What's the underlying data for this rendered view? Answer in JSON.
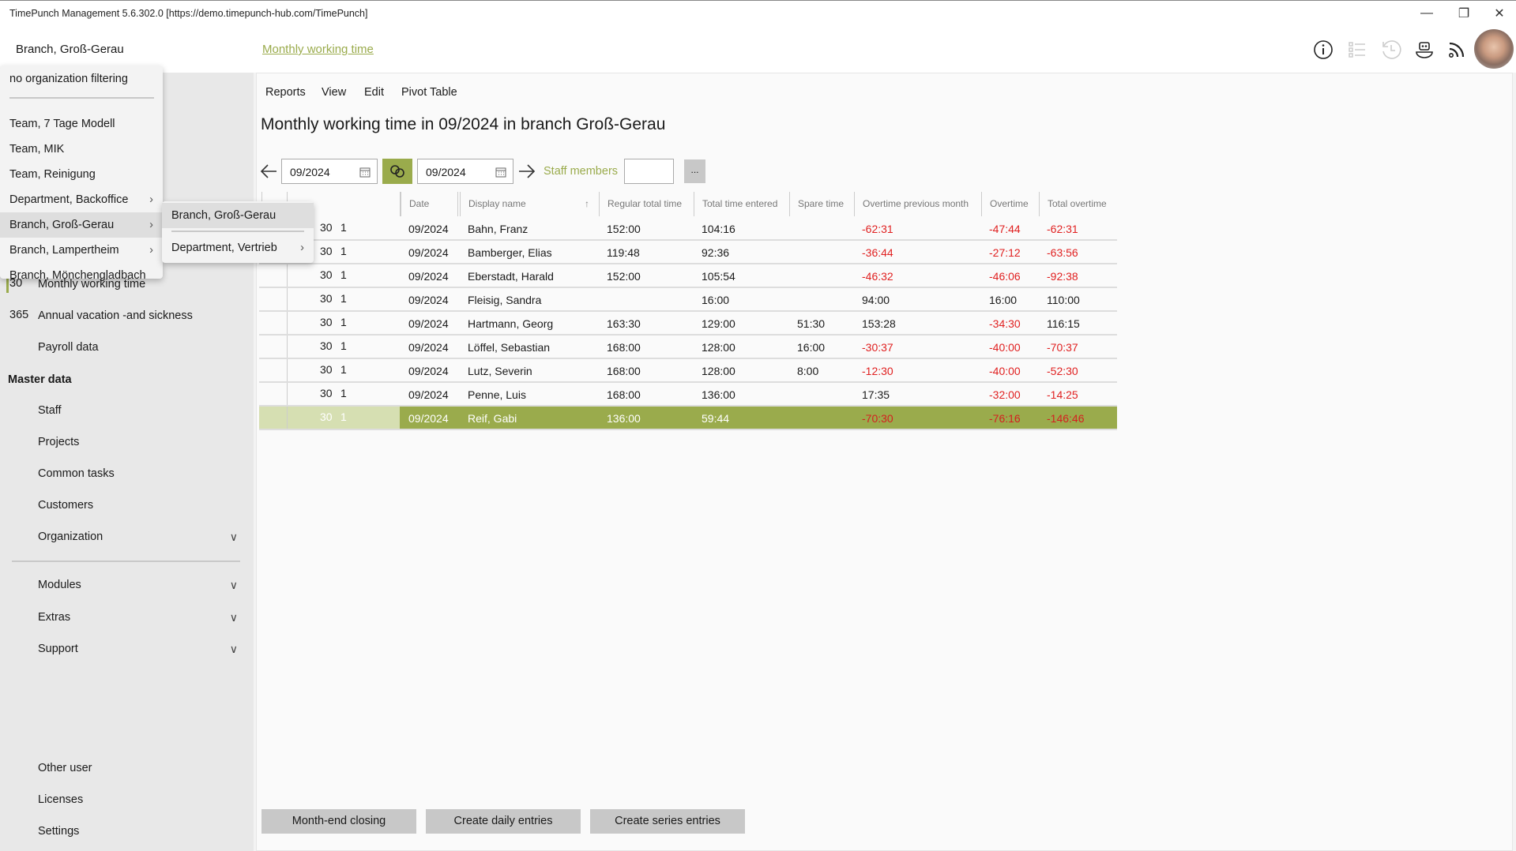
{
  "window": {
    "title": "TimePunch Management 5.6.302.0 [https://demo.timepunch-hub.com/TimePunch]"
  },
  "header": {
    "org": "Branch,  Groß-Gerau",
    "page_link": "Monthly working time",
    "icons": [
      "info-icon",
      "list-icon",
      "history-icon",
      "bot-icon",
      "rss-icon",
      "avatar"
    ]
  },
  "org_menu": {
    "items": [
      {
        "label": "no organization filtering",
        "sub": false
      },
      {
        "label": "Team,  7 Tage Modell",
        "sub": false
      },
      {
        "label": "Team,  MIK",
        "sub": false
      },
      {
        "label": "Team,  Reinigung",
        "sub": false
      },
      {
        "label": "Department,  Backoffice",
        "sub": true
      },
      {
        "label": "Branch,  Groß-Gerau",
        "sub": true,
        "highlighted": true
      },
      {
        "label": "Branch,  Lampertheim",
        "sub": true
      },
      {
        "label": "Branch,  Mönchengladbach",
        "sub": false
      }
    ],
    "submenu": [
      {
        "label": "Branch,  Groß-Gerau",
        "highlighted": true
      },
      {
        "label": "Department,  Vertrieb",
        "sub": true
      }
    ]
  },
  "sidebar": {
    "items": [
      {
        "label": "Monthly working time",
        "icon": "calendar-30-icon",
        "selected": true
      },
      {
        "label": "Annual vacation -and sickness",
        "icon": "calendar-365-icon"
      },
      {
        "label": "Payroll data",
        "icon": "calculator-icon"
      }
    ],
    "master_heading": "Master data",
    "master": [
      {
        "label": "Staff",
        "icon": "person-icon"
      },
      {
        "label": "Projects",
        "icon": "projects-icon"
      },
      {
        "label": "Common tasks",
        "icon": "list-icon"
      },
      {
        "label": "Customers",
        "icon": "customer-icon"
      },
      {
        "label": "Organization",
        "icon": "globe-icon",
        "expand": true
      }
    ],
    "groups": [
      {
        "label": "Modules"
      },
      {
        "label": "Extras"
      },
      {
        "label": "Support"
      }
    ],
    "bottom": [
      {
        "label": "Other user",
        "icon": "other-user-icon"
      },
      {
        "label": "Licenses",
        "icon": "license-icon"
      },
      {
        "label": "Settings",
        "icon": "gear-icon"
      }
    ]
  },
  "menu": [
    "Reports",
    "View",
    "Edit",
    "Pivot Table"
  ],
  "heading": "Monthly working time in 09/2024 in branch Groß-Gerau",
  "toolbar": {
    "from": "09/2024",
    "to": "09/2024",
    "staff_label": "Staff members",
    "staff_value": "",
    "more": "..."
  },
  "accent": "#9aab4c",
  "table": {
    "columns": [
      "Date",
      "Display name",
      "Regular total time",
      "Total time entered",
      "Spare time",
      "Overtime previous month",
      "Overtime",
      "Total overtime"
    ],
    "sort": "Display name ascending",
    "rows": [
      [
        "09/2024",
        "Bahn, Franz",
        "152:00",
        "104:16",
        "",
        "-62:31",
        "-47:44",
        "-62:31"
      ],
      [
        "09/2024",
        "Bamberger, Elias",
        "119:48",
        "92:36",
        "",
        "-36:44",
        "-27:12",
        "-63:56"
      ],
      [
        "09/2024",
        "Eberstadt, Harald",
        "152:00",
        "105:54",
        "",
        "-46:32",
        "-46:06",
        "-92:38"
      ],
      [
        "09/2024",
        "Fleisig, Sandra",
        "",
        "16:00",
        "",
        "94:00",
        "16:00",
        "110:00"
      ],
      [
        "09/2024",
        "Hartmann, Georg",
        "163:30",
        "129:00",
        "51:30",
        "153:28",
        "-34:30",
        "116:15"
      ],
      [
        "09/2024",
        "Löffel, Sebastian",
        "168:00",
        "128:00",
        "16:00",
        "-30:37",
        "-40:00",
        "-70:37"
      ],
      [
        "09/2024",
        "Lutz, Severin",
        "168:00",
        "128:00",
        "8:00",
        "-12:30",
        "-40:00",
        "-52:30"
      ],
      [
        "09/2024",
        "Penne, Luis",
        "168:00",
        "136:00",
        "",
        "17:35",
        "-32:00",
        "-14:25"
      ],
      [
        "09/2024",
        "Reif, Gabi",
        "136:00",
        "59:44",
        "",
        "-70:30",
        "-76:16",
        "-146:46"
      ]
    ],
    "selected_row": 8
  },
  "buttons": [
    "Month-end closing",
    "Create daily entries",
    "Create series entries"
  ]
}
